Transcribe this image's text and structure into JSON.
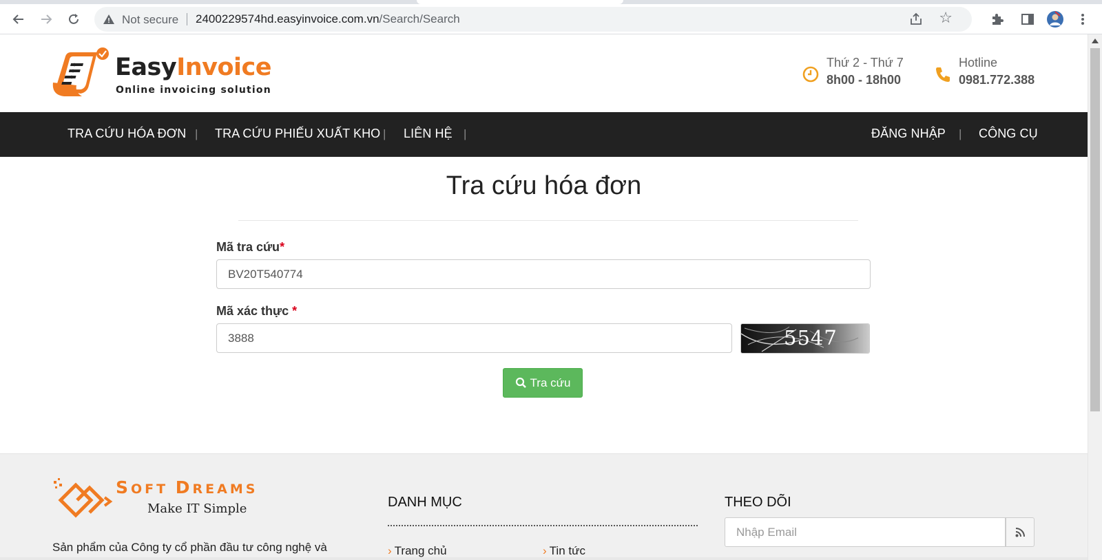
{
  "browser": {
    "security_label": "Not secure",
    "url_host": "2400229574hd.easyinvoice.com.vn",
    "url_path": "/Search/Search"
  },
  "header": {
    "logo_easy": "Easy",
    "logo_invoice": "Invoice",
    "logo_tagline": "Online invoicing solution",
    "hours_label": "Thứ 2 - Thứ 7",
    "hours_value": "8h00 - 18h00",
    "hotline_label": "Hotline",
    "hotline_value": "0981.772.388",
    "accent_color": "#f07b22"
  },
  "nav": {
    "items": [
      "TRA CỨU HÓA ĐƠN",
      "TRA CỨU PHIẾU XUẤT KHO",
      "LIÊN HỆ"
    ],
    "right_items": [
      "ĐĂNG NHẬP",
      "CÔNG CỤ"
    ],
    "separator": "|"
  },
  "main": {
    "title": "Tra cứu hóa đơn",
    "lookup_label": "Mã tra cứu",
    "lookup_value": "BV20T540774",
    "captcha_label": "Mã xác thực ",
    "captcha_input_value": "3888",
    "captcha_image_text": "5547",
    "required_mark": "*",
    "search_button": "Tra cứu",
    "button_color": "#5cb85c"
  },
  "footer": {
    "brand_s": "S",
    "brand_oft": "OFT ",
    "brand_d": "D",
    "brand_ream": "REAM",
    "brand_end": "S",
    "slogan": "Make IT Simple",
    "description": "Sản phẩm của Công ty cổ phần đầu tư công nghệ và",
    "category_heading": "DANH MỤC",
    "links": [
      "Trang chủ",
      "Tin tức"
    ],
    "follow_heading": "THEO DÕI",
    "email_placeholder": "Nhập Email"
  }
}
